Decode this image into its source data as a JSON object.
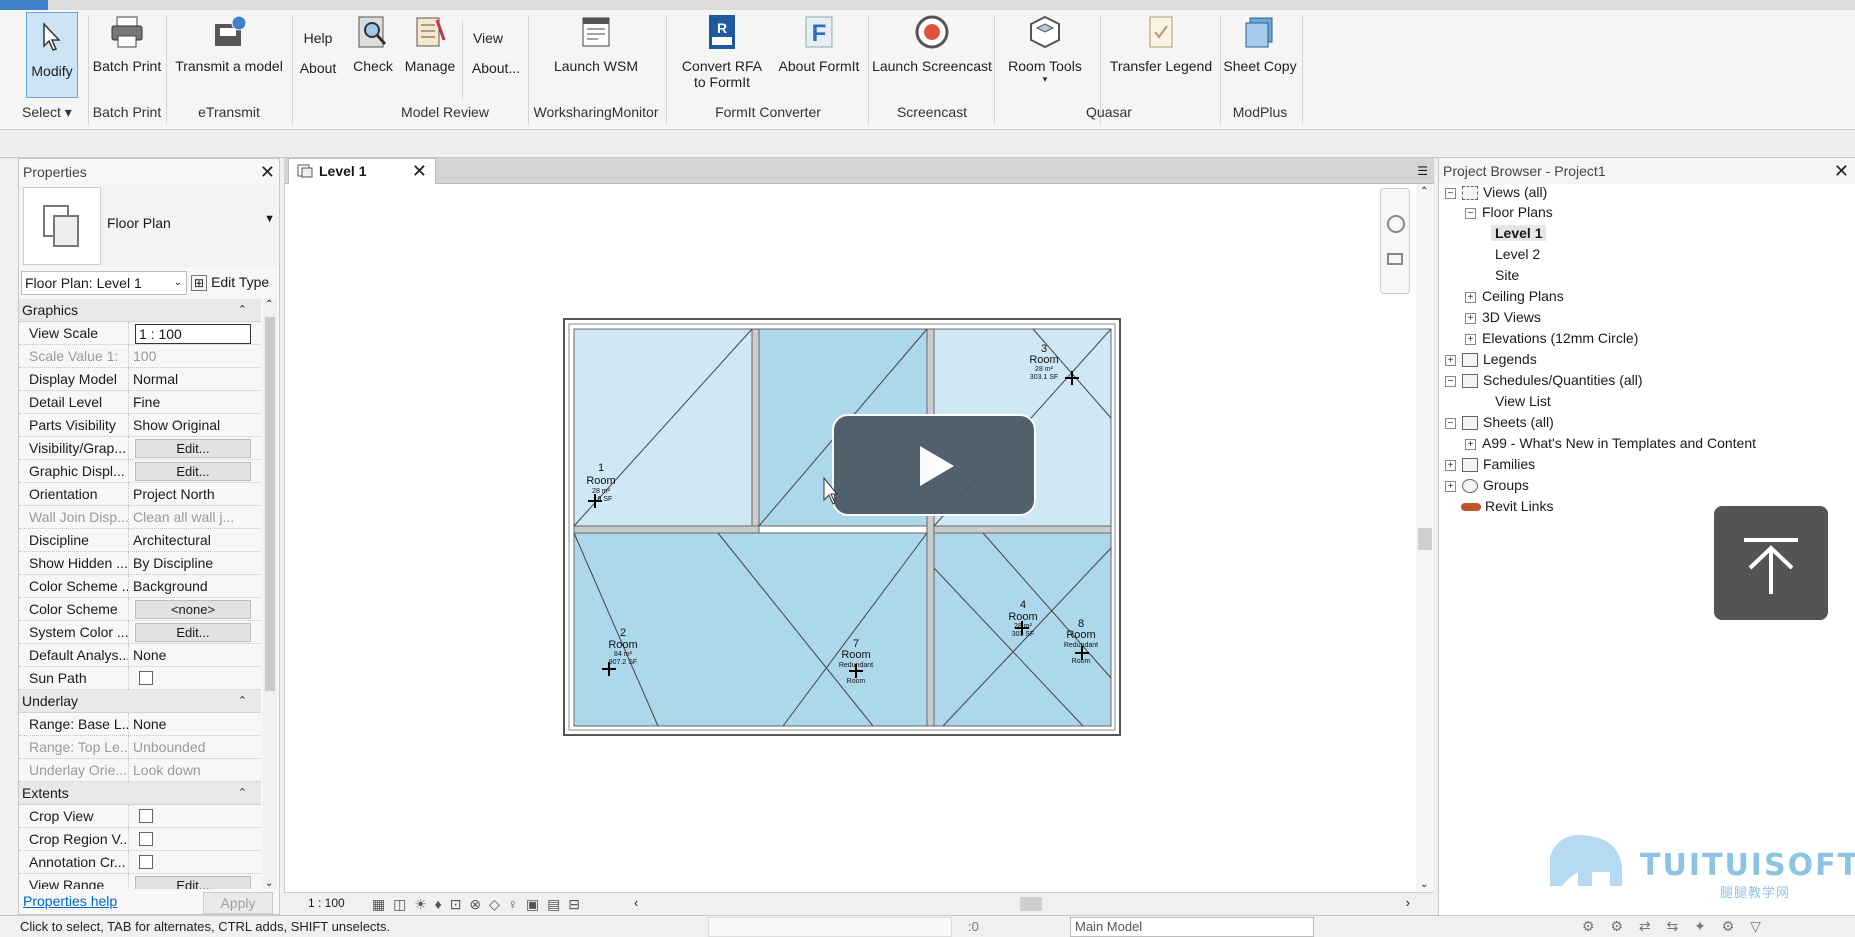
{
  "ribbon": {
    "buttons": {
      "modify": "Modify",
      "batch_print": "Batch Print",
      "transmit": "Transmit a model",
      "help": "Help",
      "about": "About",
      "check": "Check",
      "manage": "Manage",
      "view": "View",
      "about2": "About...",
      "launch_wsm": "Launch WSM",
      "convert_rfa_1": "Convert RFA",
      "convert_rfa_2": "to FormIt",
      "about_formit": "About FormIt",
      "launch_screencast": "Launch Screencast",
      "room_tools": "Room Tools",
      "transfer_legend": "Transfer Legend",
      "sheet_copy": "Sheet Copy"
    },
    "groups": {
      "select": "Select",
      "batch_print": "Batch Print",
      "etransmit": "eTransmit",
      "model_review": "Model Review",
      "wsm": "WorksharingMonitor",
      "formit": "FormIt Converter",
      "screencast": "Screencast",
      "quasar": "Quasar",
      "modplus": "ModPlus"
    }
  },
  "properties": {
    "title": "Properties",
    "type_name": "Floor Plan",
    "instance_filter": "Floor Plan: Level 1",
    "edit_type": "Edit Type",
    "sections": {
      "graphics": "Graphics",
      "underlay": "Underlay",
      "extents": "Extents"
    },
    "graphics_rows": [
      {
        "name": "View Scale",
        "value": "1 : 100"
      },
      {
        "name": "Scale Value    1:",
        "value": "100"
      },
      {
        "name": "Display Model",
        "value": "Normal"
      },
      {
        "name": "Detail Level",
        "value": "Fine"
      },
      {
        "name": "Parts Visibility",
        "value": "Show Original"
      },
      {
        "name": "Visibility/Grap...",
        "value": "Edit..."
      },
      {
        "name": "Graphic Displ...",
        "value": "Edit..."
      },
      {
        "name": "Orientation",
        "value": "Project North"
      },
      {
        "name": "Wall Join Disp...",
        "value": "Clean all wall j..."
      },
      {
        "name": "Discipline",
        "value": "Architectural"
      },
      {
        "name": "Show Hidden ...",
        "value": "By Discipline"
      },
      {
        "name": "Color Scheme ...",
        "value": "Background"
      },
      {
        "name": "Color Scheme",
        "value": "<none>"
      },
      {
        "name": "System Color ...",
        "value": "Edit..."
      },
      {
        "name": "Default Analys...",
        "value": "None"
      },
      {
        "name": "Sun Path",
        "value": ""
      }
    ],
    "underlay_rows": [
      {
        "name": "Range: Base L...",
        "value": "None"
      },
      {
        "name": "Range: Top Le...",
        "value": "Unbounded"
      },
      {
        "name": "Underlay Orie...",
        "value": "Look down"
      }
    ],
    "extents_rows": [
      {
        "name": "Crop View",
        "value": ""
      },
      {
        "name": "Crop Region V...",
        "value": ""
      },
      {
        "name": "Annotation Cr...",
        "value": ""
      },
      {
        "name": "View Range",
        "value": "Edit..."
      }
    ],
    "help_link": "Properties help",
    "apply": "Apply"
  },
  "view": {
    "tab": "Level 1",
    "scale": "1 : 100"
  },
  "plan": {
    "rooms": [
      {
        "num": "1",
        "name": "Room",
        "area": "28 m²",
        "sf": "..9 SF"
      },
      {
        "num": "2",
        "name": "Room",
        "area": "84 m²",
        "sf": "907.2 SF"
      },
      {
        "num": "3",
        "name": "Room",
        "area": "28 m²",
        "sf": "303.1 SF"
      },
      {
        "num": "4",
        "name": "Room",
        "area": "28 m²",
        "sf": "303 SF"
      },
      {
        "num": "7",
        "name": "Room",
        "area": "Redundant",
        "sf": "Room"
      },
      {
        "num": "8",
        "name": "Room",
        "area": "Redundant",
        "sf": "Room"
      }
    ]
  },
  "browser": {
    "title": "Project Browser - Project1",
    "items": [
      {
        "label": "Views (all)"
      },
      {
        "label": "Floor Plans"
      },
      {
        "label": "Level 1"
      },
      {
        "label": "Level 2"
      },
      {
        "label": "Site"
      },
      {
        "label": "Ceiling Plans"
      },
      {
        "label": "3D Views"
      },
      {
        "label": "Elevations (12mm Circle)"
      },
      {
        "label": "Legends"
      },
      {
        "label": "Schedules/Quantities (all)"
      },
      {
        "label": "View List"
      },
      {
        "label": "Sheets (all)"
      },
      {
        "label": "A99 - What's New in Templates and Content"
      },
      {
        "label": "Families"
      },
      {
        "label": "Groups"
      },
      {
        "label": "Revit Links"
      }
    ]
  },
  "watermark": {
    "brand": "TUITUISOFT",
    "sub": "腿腿教学网"
  },
  "status": {
    "text": "Click to select, TAB for alternates, CTRL adds, SHIFT unselects.",
    "zero": ":0",
    "model": "Main Model"
  },
  "colors": {
    "accent": "#3d82c6",
    "room_fill": "#add8ec",
    "room_fill_light": "#cfe8f5"
  }
}
